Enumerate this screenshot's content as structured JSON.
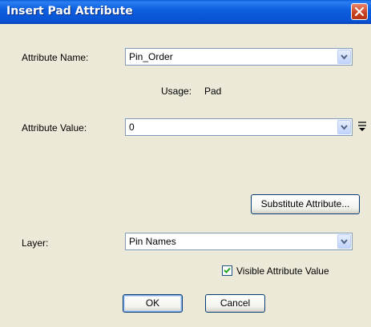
{
  "window": {
    "title": "Insert Pad Attribute"
  },
  "attribute_name": {
    "label": "Attribute Name:",
    "value": "Pin_Order"
  },
  "usage": {
    "label": "Usage:",
    "value": "Pad"
  },
  "attribute_value": {
    "label": "Attribute Value:",
    "value": "0"
  },
  "substitute_button": "Substitute Attribute...",
  "layer": {
    "label": "Layer:",
    "value": "Pin Names"
  },
  "visible_checkbox": {
    "label": "Visible Attribute Value",
    "checked": true
  },
  "ok_button": "OK",
  "cancel_button": "Cancel",
  "icons": {
    "close": "close-icon",
    "dropdown": "chevron-down-icon",
    "expand": "expand-icon",
    "check": "checkmark-icon"
  }
}
